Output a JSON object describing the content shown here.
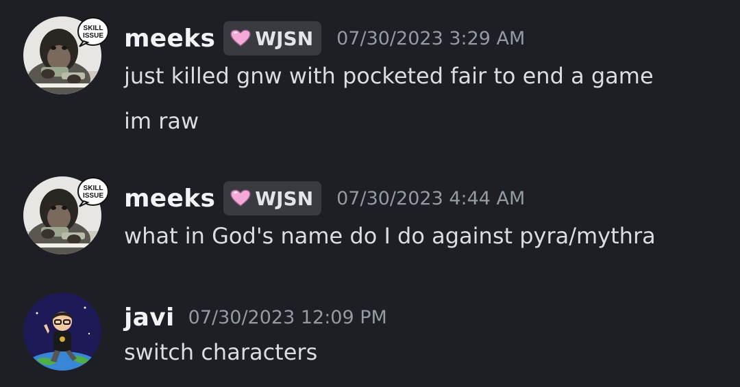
{
  "messages": [
    {
      "username": "meeks",
      "tag": "WJSN",
      "tag_icon": "pink-heart-icon",
      "timestamp": "07/30/2023 3:29 AM",
      "avatar_badge": "SKILL ISSUE",
      "lines": [
        "just killed gnw with pocketed fair to end a game",
        "im raw"
      ]
    },
    {
      "username": "meeks",
      "tag": "WJSN",
      "tag_icon": "pink-heart-icon",
      "timestamp": "07/30/2023 4:44 AM",
      "avatar_badge": "SKILL ISSUE",
      "lines": [
        "what in God's name do I do against pyra/mythra"
      ]
    },
    {
      "username": "javi",
      "timestamp": "07/30/2023 12:09 PM",
      "lines": [
        "switch characters"
      ]
    }
  ],
  "colors": {
    "background": "#1e1f24",
    "username": "#f2f3f5",
    "message_text": "#dbdee1",
    "timestamp": "#949ba4",
    "tag_background": "#393b41",
    "heart": "#f5a9d8"
  }
}
